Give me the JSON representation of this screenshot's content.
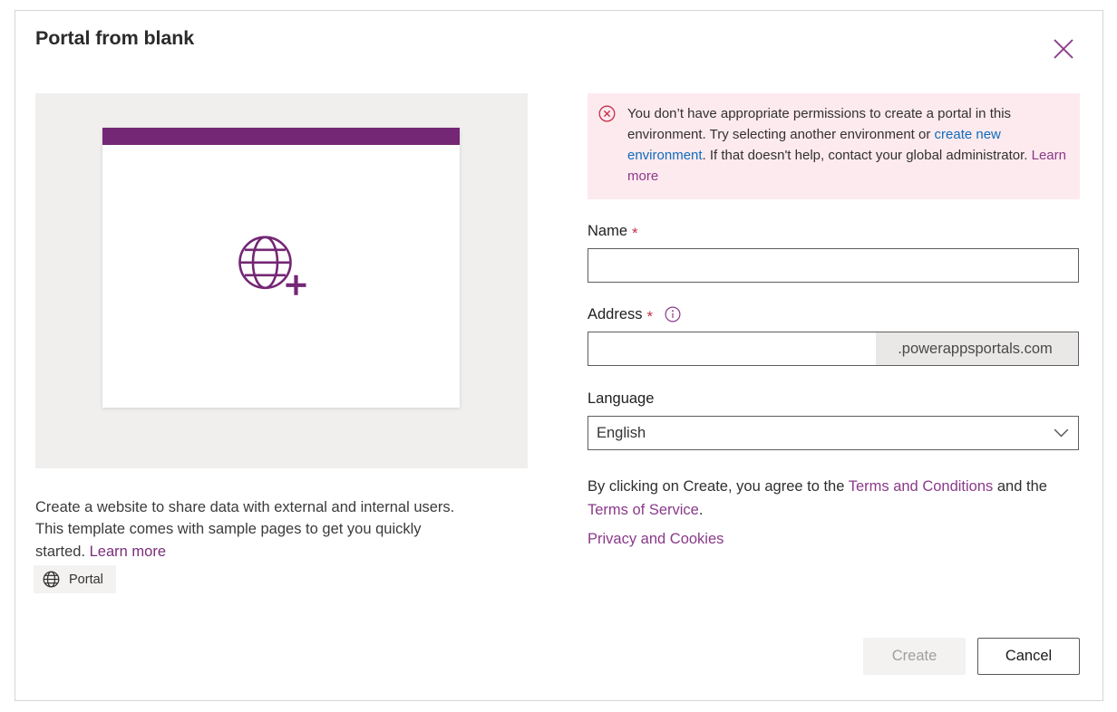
{
  "dialog": {
    "title": "Portal from blank",
    "close_icon": "close-icon"
  },
  "preview": {
    "globe_icon": "globe-plus-icon",
    "topbar_color": "#742774",
    "panel_background": "#f0efee",
    "card_background": "#ffffff"
  },
  "template": {
    "description_part1": "Create a website to share data with external and internal users. This template comes with sample pages to get you quickly started. ",
    "learn_more_label": "Learn more",
    "badge": {
      "icon": "globe-icon",
      "label": "Portal"
    }
  },
  "error": {
    "icon": "error-circle-x-icon",
    "text_part1": "You don’t have appropriate permissions to create a portal in this environment. Try selecting another environment or ",
    "link_create_environment": "create new environment",
    "text_part2": ". If that doesn't help, contact your global administrator. ",
    "link_learn_more": "Learn more",
    "background_color": "#fdeaee",
    "icon_color": "#c4314b",
    "link_color": "#0f6cbd",
    "learn_more_color": "#8a3a8a"
  },
  "form": {
    "name": {
      "label": "Name",
      "required_marker": "*",
      "value": "",
      "placeholder": ""
    },
    "address": {
      "label": "Address",
      "required_marker": "*",
      "info_icon": "info-circle-icon",
      "value": "",
      "placeholder": "",
      "suffix": ".powerappsportals.com"
    },
    "language": {
      "label": "Language",
      "selected": "English",
      "chevron_icon": "chevron-down-icon",
      "options": [
        "English"
      ]
    }
  },
  "legal": {
    "text_part1": "By clicking on Create, you agree to the ",
    "terms_and_conditions": "Terms and Conditions",
    "text_part2": " and the ",
    "terms_of_service": "Terms of Service",
    "text_part3": ".",
    "privacy_and_cookies": "Privacy and Cookies",
    "link_color": "#8a3a8a"
  },
  "footer": {
    "create_label": "Create",
    "create_disabled": "true",
    "cancel_label": "Cancel"
  }
}
